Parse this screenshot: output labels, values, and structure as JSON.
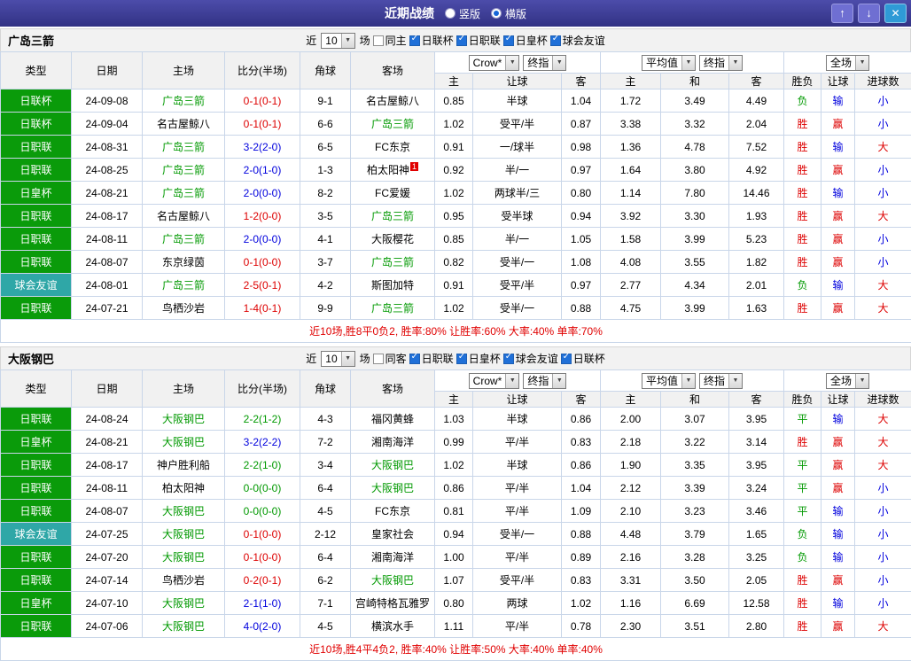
{
  "topbar": {
    "title": "近期战绩",
    "vertical_label": "竖版",
    "horizontal_label": "横版",
    "vertical_selected": false,
    "horizontal_selected": true,
    "up_icon": "↑",
    "down_icon": "↓",
    "close_icon": "✕"
  },
  "filter_labels": {
    "near": "近",
    "count": "10",
    "games": "场"
  },
  "table_headers": {
    "type": "类型",
    "date": "日期",
    "home": "主场",
    "score": "比分(半场)",
    "corner": "角球",
    "away": "客场",
    "asian": [
      "主",
      "让球",
      "客"
    ],
    "euro": [
      "主",
      "和",
      "客"
    ],
    "result": [
      "胜负",
      "让球",
      "进球数"
    ]
  },
  "colors": {
    "focal_team": "#009900",
    "win": "#dd0000",
    "draw": "#009900",
    "home_win_score": "#0000dd",
    "away_win_score": "#dd0000",
    "league_badge": "#0a9b0a",
    "friendly_badge": "#2fa7a7"
  },
  "sections": [
    {
      "team": "广岛三箭",
      "same_label": "同主",
      "same_checked": false,
      "leagues": [
        {
          "label": "日联杯",
          "checked": true
        },
        {
          "label": "日职联",
          "checked": true
        },
        {
          "label": "日皇杯",
          "checked": true
        },
        {
          "label": "球会友谊",
          "checked": true
        }
      ],
      "dropdowns": {
        "bookmaker": "Crow*",
        "time1": "终指",
        "euro": "平均值",
        "time2": "终指",
        "scope": "全场"
      },
      "rows": [
        {
          "type": "日联杯",
          "type_style": "green",
          "date": "24-09-08",
          "home": "广岛三箭",
          "home_focal": true,
          "score": "0-1(0-1)",
          "score_style": "red",
          "corner": "9-1",
          "away": "名古屋鲸八",
          "away_focal": false,
          "red_card": "",
          "oh": "0.85",
          "hc": "半球",
          "oa": "1.04",
          "eh": "1.72",
          "ed": "3.49",
          "ea": "4.49",
          "res": "负",
          "res_style": "green",
          "hres": "输",
          "hres_style": "blue",
          "goal": "小",
          "goal_style": "blue"
        },
        {
          "type": "日联杯",
          "type_style": "green",
          "date": "24-09-04",
          "home": "名古屋鲸八",
          "home_focal": false,
          "score": "0-1(0-1)",
          "score_style": "red",
          "corner": "6-6",
          "away": "广岛三箭",
          "away_focal": true,
          "red_card": "",
          "oh": "1.02",
          "hc": "受平/半",
          "oa": "0.87",
          "eh": "3.38",
          "ed": "3.32",
          "ea": "2.04",
          "res": "胜",
          "res_style": "red",
          "hres": "赢",
          "hres_style": "red",
          "goal": "小",
          "goal_style": "blue"
        },
        {
          "type": "日职联",
          "type_style": "green",
          "date": "24-08-31",
          "home": "广岛三箭",
          "home_focal": true,
          "score": "3-2(2-0)",
          "score_style": "blue",
          "corner": "6-5",
          "away": "FC东京",
          "away_focal": false,
          "red_card": "",
          "oh": "0.91",
          "hc": "一/球半",
          "oa": "0.98",
          "eh": "1.36",
          "ed": "4.78",
          "ea": "7.52",
          "res": "胜",
          "res_style": "red",
          "hres": "输",
          "hres_style": "blue",
          "goal": "大",
          "goal_style": "red"
        },
        {
          "type": "日职联",
          "type_style": "green",
          "date": "24-08-25",
          "home": "广岛三箭",
          "home_focal": true,
          "score": "2-0(1-0)",
          "score_style": "blue",
          "corner": "1-3",
          "away": "柏太阳神",
          "away_focal": false,
          "red_card": "1",
          "oh": "0.92",
          "hc": "半/一",
          "oa": "0.97",
          "eh": "1.64",
          "ed": "3.80",
          "ea": "4.92",
          "res": "胜",
          "res_style": "red",
          "hres": "赢",
          "hres_style": "red",
          "goal": "小",
          "goal_style": "blue"
        },
        {
          "type": "日皇杯",
          "type_style": "green",
          "date": "24-08-21",
          "home": "广岛三箭",
          "home_focal": true,
          "score": "2-0(0-0)",
          "score_style": "blue",
          "corner": "8-2",
          "away": "FC爱媛",
          "away_focal": false,
          "red_card": "",
          "oh": "1.02",
          "hc": "两球半/三",
          "oa": "0.80",
          "eh": "1.14",
          "ed": "7.80",
          "ea": "14.46",
          "res": "胜",
          "res_style": "red",
          "hres": "输",
          "hres_style": "blue",
          "goal": "小",
          "goal_style": "blue"
        },
        {
          "type": "日职联",
          "type_style": "green",
          "date": "24-08-17",
          "home": "名古屋鲸八",
          "home_focal": false,
          "score": "1-2(0-0)",
          "score_style": "red",
          "corner": "3-5",
          "away": "广岛三箭",
          "away_focal": true,
          "red_card": "",
          "oh": "0.95",
          "hc": "受半球",
          "oa": "0.94",
          "eh": "3.92",
          "ed": "3.30",
          "ea": "1.93",
          "res": "胜",
          "res_style": "red",
          "hres": "赢",
          "hres_style": "red",
          "goal": "大",
          "goal_style": "red"
        },
        {
          "type": "日职联",
          "type_style": "green",
          "date": "24-08-11",
          "home": "广岛三箭",
          "home_focal": true,
          "score": "2-0(0-0)",
          "score_style": "blue",
          "corner": "4-1",
          "away": "大阪樱花",
          "away_focal": false,
          "red_card": "",
          "oh": "0.85",
          "hc": "半/一",
          "oa": "1.05",
          "eh": "1.58",
          "ed": "3.99",
          "ea": "5.23",
          "res": "胜",
          "res_style": "red",
          "hres": "赢",
          "hres_style": "red",
          "goal": "小",
          "goal_style": "blue"
        },
        {
          "type": "日职联",
          "type_style": "green",
          "date": "24-08-07",
          "home": "东京绿茵",
          "home_focal": false,
          "score": "0-1(0-0)",
          "score_style": "red",
          "corner": "3-7",
          "away": "广岛三箭",
          "away_focal": true,
          "red_card": "",
          "oh": "0.82",
          "hc": "受半/一",
          "oa": "1.08",
          "eh": "4.08",
          "ed": "3.55",
          "ea": "1.82",
          "res": "胜",
          "res_style": "red",
          "hres": "赢",
          "hres_style": "red",
          "goal": "小",
          "goal_style": "blue"
        },
        {
          "type": "球会友谊",
          "type_style": "teal",
          "date": "24-08-01",
          "home": "广岛三箭",
          "home_focal": true,
          "score": "2-5(0-1)",
          "score_style": "red",
          "corner": "4-2",
          "away": "斯图加特",
          "away_focal": false,
          "red_card": "",
          "oh": "0.91",
          "hc": "受平/半",
          "oa": "0.97",
          "eh": "2.77",
          "ed": "4.34",
          "ea": "2.01",
          "res": "负",
          "res_style": "green",
          "hres": "输",
          "hres_style": "blue",
          "goal": "大",
          "goal_style": "red"
        },
        {
          "type": "日职联",
          "type_style": "green",
          "date": "24-07-21",
          "home": "鸟栖沙岩",
          "home_focal": false,
          "score": "1-4(0-1)",
          "score_style": "red",
          "corner": "9-9",
          "away": "广岛三箭",
          "away_focal": true,
          "red_card": "",
          "oh": "1.02",
          "hc": "受半/一",
          "oa": "0.88",
          "eh": "4.75",
          "ed": "3.99",
          "ea": "1.63",
          "res": "胜",
          "res_style": "red",
          "hres": "赢",
          "hres_style": "red",
          "goal": "大",
          "goal_style": "red"
        }
      ],
      "summary": {
        "record": "近10场,胜8平0负2,",
        "rates": [
          "胜率:80%",
          "让胜率:60%",
          "大率:40%",
          "单率:70%"
        ]
      }
    },
    {
      "team": "大阪钢巴",
      "same_label": "同客",
      "same_checked": false,
      "leagues": [
        {
          "label": "日职联",
          "checked": true
        },
        {
          "label": "日皇杯",
          "checked": true
        },
        {
          "label": "球会友谊",
          "checked": true
        },
        {
          "label": "日联杯",
          "checked": true
        }
      ],
      "dropdowns": {
        "bookmaker": "Crow*",
        "time1": "终指",
        "euro": "平均值",
        "time2": "终指",
        "scope": "全场"
      },
      "rows": [
        {
          "type": "日职联",
          "type_style": "green",
          "date": "24-08-24",
          "home": "大阪钢巴",
          "home_focal": true,
          "score": "2-2(1-2)",
          "score_style": "green",
          "corner": "4-3",
          "away": "福冈黄蜂",
          "away_focal": false,
          "red_card": "",
          "oh": "1.03",
          "hc": "半球",
          "oa": "0.86",
          "eh": "2.00",
          "ed": "3.07",
          "ea": "3.95",
          "res": "平",
          "res_style": "green",
          "hres": "输",
          "hres_style": "blue",
          "goal": "大",
          "goal_style": "red"
        },
        {
          "type": "日皇杯",
          "type_style": "green",
          "date": "24-08-21",
          "home": "大阪钢巴",
          "home_focal": true,
          "score": "3-2(2-2)",
          "score_style": "blue",
          "corner": "7-2",
          "away": "湘南海洋",
          "away_focal": false,
          "red_card": "",
          "oh": "0.99",
          "hc": "平/半",
          "oa": "0.83",
          "eh": "2.18",
          "ed": "3.22",
          "ea": "3.14",
          "res": "胜",
          "res_style": "red",
          "hres": "赢",
          "hres_style": "red",
          "goal": "大",
          "goal_style": "red"
        },
        {
          "type": "日职联",
          "type_style": "green",
          "date": "24-08-17",
          "home": "神户胜利船",
          "home_focal": false,
          "score": "2-2(1-0)",
          "score_style": "green",
          "corner": "3-4",
          "away": "大阪钢巴",
          "away_focal": true,
          "red_card": "",
          "oh": "1.02",
          "hc": "半球",
          "oa": "0.86",
          "eh": "1.90",
          "ed": "3.35",
          "ea": "3.95",
          "res": "平",
          "res_style": "green",
          "hres": "赢",
          "hres_style": "red",
          "goal": "大",
          "goal_style": "red"
        },
        {
          "type": "日职联",
          "type_style": "green",
          "date": "24-08-11",
          "home": "柏太阳神",
          "home_focal": false,
          "score": "0-0(0-0)",
          "score_style": "green",
          "corner": "6-4",
          "away": "大阪钢巴",
          "away_focal": true,
          "red_card": "",
          "oh": "0.86",
          "hc": "平/半",
          "oa": "1.04",
          "eh": "2.12",
          "ed": "3.39",
          "ea": "3.24",
          "res": "平",
          "res_style": "green",
          "hres": "赢",
          "hres_style": "red",
          "goal": "小",
          "goal_style": "blue"
        },
        {
          "type": "日职联",
          "type_style": "green",
          "date": "24-08-07",
          "home": "大阪钢巴",
          "home_focal": true,
          "score": "0-0(0-0)",
          "score_style": "green",
          "corner": "4-5",
          "away": "FC东京",
          "away_focal": false,
          "red_card": "",
          "oh": "0.81",
          "hc": "平/半",
          "oa": "1.09",
          "eh": "2.10",
          "ed": "3.23",
          "ea": "3.46",
          "res": "平",
          "res_style": "green",
          "hres": "输",
          "hres_style": "blue",
          "goal": "小",
          "goal_style": "blue"
        },
        {
          "type": "球会友谊",
          "type_style": "teal",
          "date": "24-07-25",
          "home": "大阪钢巴",
          "home_focal": true,
          "score": "0-1(0-0)",
          "score_style": "red",
          "corner": "2-12",
          "away": "皇家社会",
          "away_focal": false,
          "red_card": "",
          "oh": "0.94",
          "hc": "受半/一",
          "oa": "0.88",
          "eh": "4.48",
          "ed": "3.79",
          "ea": "1.65",
          "res": "负",
          "res_style": "green",
          "hres": "输",
          "hres_style": "blue",
          "goal": "小",
          "goal_style": "blue"
        },
        {
          "type": "日职联",
          "type_style": "green",
          "date": "24-07-20",
          "home": "大阪钢巴",
          "home_focal": true,
          "score": "0-1(0-0)",
          "score_style": "red",
          "corner": "6-4",
          "away": "湘南海洋",
          "away_focal": false,
          "red_card": "",
          "oh": "1.00",
          "hc": "平/半",
          "oa": "0.89",
          "eh": "2.16",
          "ed": "3.28",
          "ea": "3.25",
          "res": "负",
          "res_style": "green",
          "hres": "输",
          "hres_style": "blue",
          "goal": "小",
          "goal_style": "blue"
        },
        {
          "type": "日职联",
          "type_style": "green",
          "date": "24-07-14",
          "home": "鸟栖沙岩",
          "home_focal": false,
          "score": "0-2(0-1)",
          "score_style": "red",
          "corner": "6-2",
          "away": "大阪钢巴",
          "away_focal": true,
          "red_card": "",
          "oh": "1.07",
          "hc": "受平/半",
          "oa": "0.83",
          "eh": "3.31",
          "ed": "3.50",
          "ea": "2.05",
          "res": "胜",
          "res_style": "red",
          "hres": "赢",
          "hres_style": "red",
          "goal": "小",
          "goal_style": "blue"
        },
        {
          "type": "日皇杯",
          "type_style": "green",
          "date": "24-07-10",
          "home": "大阪钢巴",
          "home_focal": true,
          "score": "2-1(1-0)",
          "score_style": "blue",
          "corner": "7-1",
          "away": "宫崎特格瓦雅罗",
          "away_focal": false,
          "red_card": "",
          "oh": "0.80",
          "hc": "两球",
          "oa": "1.02",
          "eh": "1.16",
          "ed": "6.69",
          "ea": "12.58",
          "res": "胜",
          "res_style": "red",
          "hres": "输",
          "hres_style": "blue",
          "goal": "小",
          "goal_style": "blue"
        },
        {
          "type": "日职联",
          "type_style": "green",
          "date": "24-07-06",
          "home": "大阪钢巴",
          "home_focal": true,
          "score": "4-0(2-0)",
          "score_style": "blue",
          "corner": "4-5",
          "away": "横滨水手",
          "away_focal": false,
          "red_card": "",
          "oh": "1.11",
          "hc": "平/半",
          "oa": "0.78",
          "eh": "2.30",
          "ed": "3.51",
          "ea": "2.80",
          "res": "胜",
          "res_style": "red",
          "hres": "赢",
          "hres_style": "red",
          "goal": "大",
          "goal_style": "red"
        }
      ],
      "summary": {
        "record": "近10场,胜4平4负2,",
        "rates": [
          "胜率:40%",
          "让胜率:50%",
          "大率:40%",
          "单率:40%"
        ]
      }
    }
  ]
}
